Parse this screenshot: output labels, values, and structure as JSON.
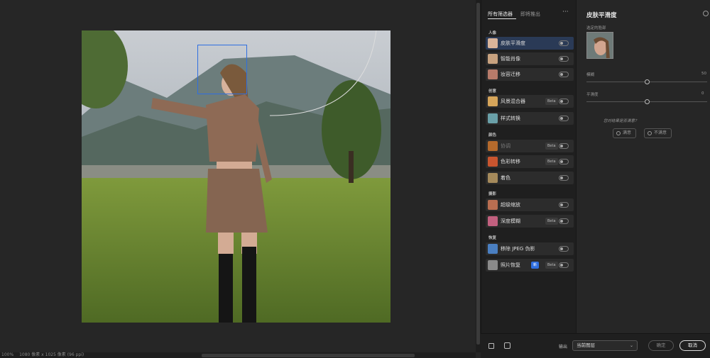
{
  "status": {
    "zoom": "100%",
    "doc_info": "1080 像素 x 1025 像素 (96 ppi)"
  },
  "filters": {
    "tabs": [
      "所有筛选器",
      "即将推出"
    ],
    "more": "···",
    "categories": [
      {
        "label": "人像",
        "items": [
          {
            "label": "皮肤平滑度",
            "selected": true,
            "color": "#d9b49a"
          },
          {
            "label": "智能肖像",
            "color": "#c8a27f"
          },
          {
            "label": "妆容迁移",
            "color": "#b77b6a"
          }
        ]
      },
      {
        "label": "创意",
        "items": [
          {
            "label": "风景混合器",
            "badge": "Beta",
            "color": "#d6a55a"
          },
          {
            "label": "样式转换",
            "color": "#6aa0a8"
          }
        ]
      },
      {
        "label": "颜色",
        "items": [
          {
            "label": "协调",
            "badge": "Beta",
            "disabled": true,
            "color": "#b56a2c"
          },
          {
            "label": "色彩转移",
            "badge": "Beta",
            "color": "#c9552f"
          },
          {
            "label": "着色",
            "color": "#a58a5b"
          }
        ]
      },
      {
        "label": "摄影",
        "items": [
          {
            "label": "超级缩放",
            "color": "#b96e51"
          },
          {
            "label": "深度模糊",
            "badge": "Beta",
            "color": "#c2607f"
          }
        ]
      },
      {
        "label": "恢复",
        "items": [
          {
            "label": "移除 JPEG 伪影",
            "color": "#4a7fc1"
          },
          {
            "label": "照片恢复",
            "badge_new": "新",
            "badge": "Beta",
            "color": "#8a8a8a"
          }
        ]
      }
    ]
  },
  "props": {
    "title": "皮肤平滑度",
    "face_label": "选定的脸部",
    "sliders": [
      {
        "label": "模糊",
        "value": 50,
        "display": "50"
      },
      {
        "label": "平滑度",
        "value": 50,
        "display": "0"
      }
    ],
    "feedback_question": "您对结果是否满意？",
    "satisfied": "满意",
    "not_satisfied": "不满意"
  },
  "bottom": {
    "output_label": "输出",
    "output_value": "当前图层",
    "ok": "确定",
    "cancel": "取消"
  },
  "colors": {
    "accent": "#2f6fe0",
    "selected_item": "#2a3a56"
  }
}
